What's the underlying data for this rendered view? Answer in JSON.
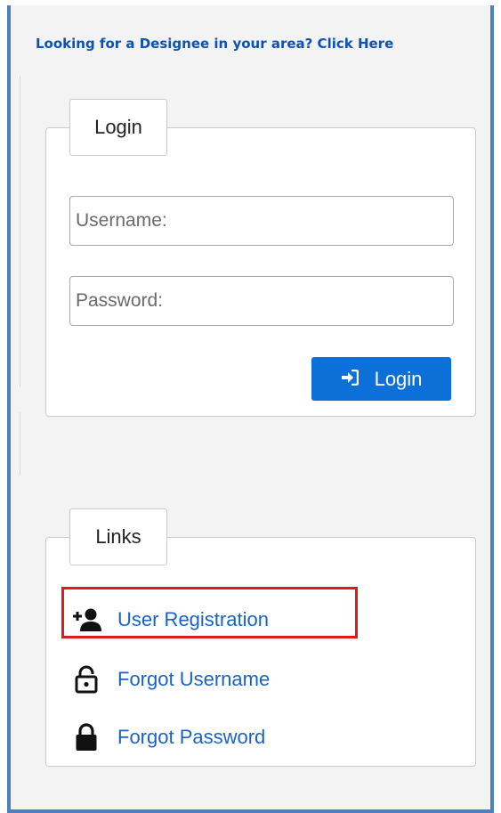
{
  "header": {
    "designee_link": "Looking for a Designee in your area? Click Here"
  },
  "login_panel": {
    "legend": "Login",
    "username_placeholder": "Username:",
    "password_placeholder": "Password:",
    "username_value": "",
    "password_value": "",
    "submit_label": "Login",
    "submit_icon": "sign-in-icon"
  },
  "links_panel": {
    "legend": "Links",
    "items": [
      {
        "label": "User Registration",
        "icon": "user-plus-icon",
        "highlighted": true
      },
      {
        "label": "Forgot Username",
        "icon": "lock-open-icon"
      },
      {
        "label": "Forgot Password",
        "icon": "lock-icon"
      }
    ]
  },
  "colors": {
    "frame_border": "#4e7fc0",
    "link_blue": "#1a63c6",
    "header_link": "#0b53b5",
    "button_blue": "#0d6fd8",
    "highlight_red": "#e01919"
  }
}
